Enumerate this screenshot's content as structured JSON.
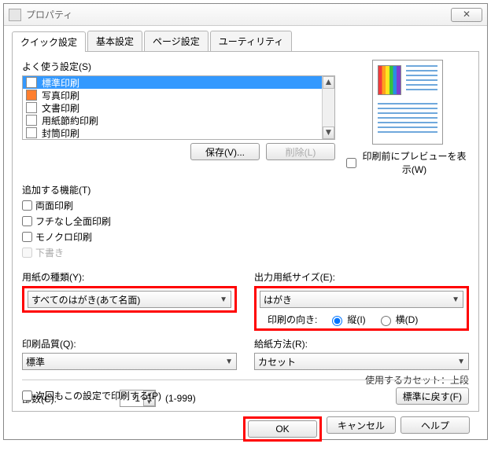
{
  "window": {
    "title_suffix": "プロパティ"
  },
  "tabs": {
    "quick": "クイック設定",
    "basic": "基本設定",
    "page": "ページ設定",
    "util": "ユーティリティ"
  },
  "freq": {
    "label": "よく使う設定(S)",
    "items": [
      "標準印刷",
      "写真印刷",
      "文書印刷",
      "用紙節約印刷",
      "封筒印刷"
    ],
    "save_btn": "保存(V)...",
    "delete_btn": "削除(L)"
  },
  "preview": {
    "check_label": "印刷前にプレビューを表示(W)"
  },
  "addfunc": {
    "label": "追加する機能(T)",
    "duplex": "両面印刷",
    "borderless": "フチなし全面印刷",
    "mono": "モノクロ印刷",
    "draft": "下書き"
  },
  "papertype": {
    "label": "用紙の種類(Y):",
    "value": "すべてのはがき(あて名面)"
  },
  "outputsize": {
    "label": "出力用紙サイズ(E):",
    "value": "はがき"
  },
  "orientation": {
    "label": "印刷の向き:",
    "portrait": "縦(I)",
    "landscape": "横(D)"
  },
  "quality": {
    "label": "印刷品質(Q):",
    "value": "標準"
  },
  "source": {
    "label": "給紙方法(R):",
    "value": "カセット",
    "note": "使用するカセット：上段"
  },
  "copies": {
    "label": "部数(C):",
    "value": "1",
    "range": "(1-999)"
  },
  "footer": {
    "always": "次回もこの設定で印刷する(P)",
    "restore": "標準に戻す(F)"
  },
  "buttons": {
    "ok": "OK",
    "cancel": "キャンセル",
    "help": "ヘルプ"
  }
}
